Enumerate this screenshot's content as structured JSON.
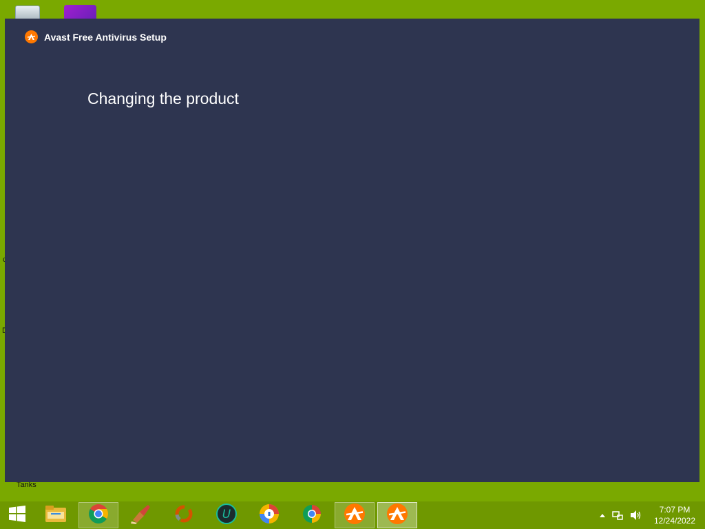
{
  "window": {
    "title": "Avast Free Antivirus Setup",
    "heading": "Changing the product"
  },
  "desktop": {
    "labels": {
      "tanks": "Tanks"
    }
  },
  "taskbar": {
    "apps": [
      {
        "name": "start-button",
        "icon": "windows-logo-icon"
      },
      {
        "name": "file-explorer",
        "icon": "folder-icon"
      },
      {
        "name": "chrome",
        "icon": "chrome-icon"
      },
      {
        "name": "ccleaner",
        "icon": "ccleaner-icon"
      },
      {
        "name": "app-ring",
        "icon": "ring-icon"
      },
      {
        "name": "ucbrowser",
        "icon": "u-icon"
      },
      {
        "name": "secure-browser",
        "icon": "shield-browser-icon"
      },
      {
        "name": "browser-2",
        "icon": "chromium-icon"
      },
      {
        "name": "avast-1",
        "icon": "avast-icon"
      },
      {
        "name": "avast-2",
        "icon": "avast-icon"
      }
    ],
    "clock": {
      "time": "7:07 PM",
      "date": "12/24/2022"
    }
  },
  "colors": {
    "desktop": "#7aa900",
    "window": "#2e3550",
    "taskbar": "#6f9800",
    "avast_orange": "#ff7800"
  }
}
